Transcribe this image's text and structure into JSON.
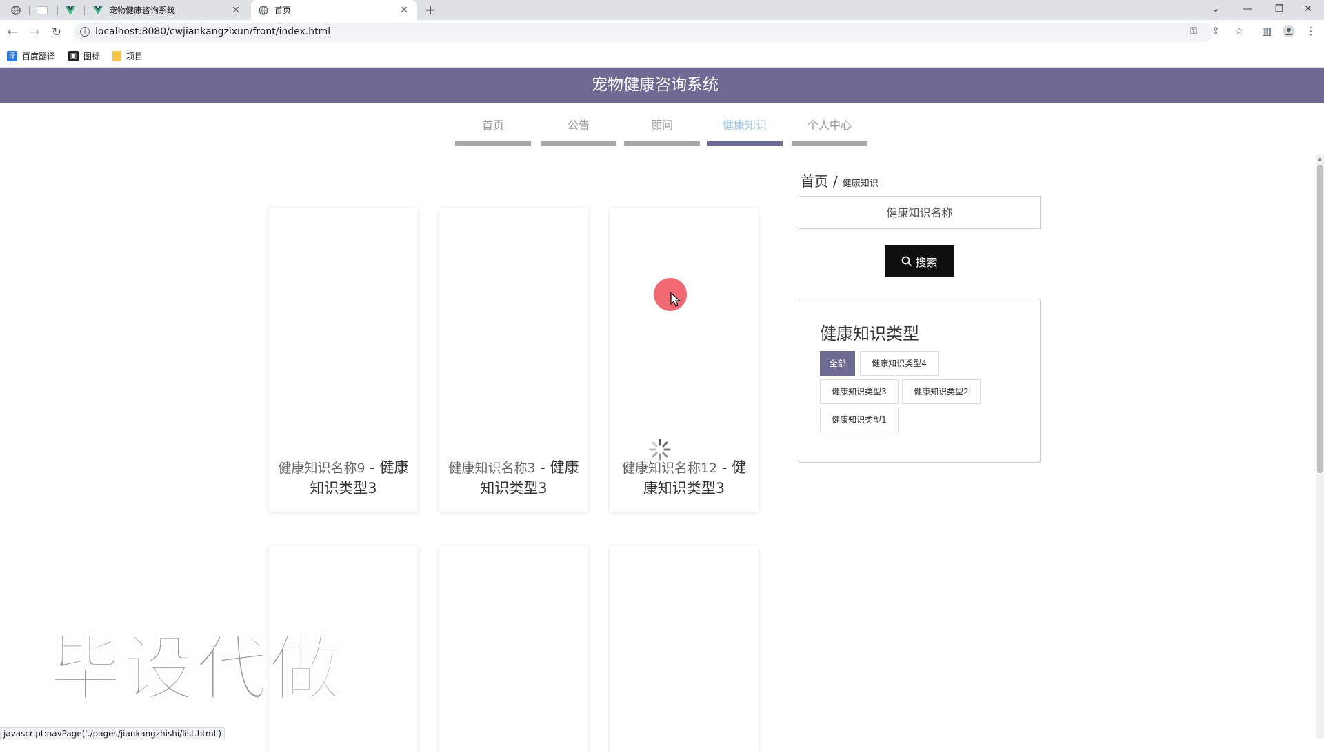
{
  "browser": {
    "tabs": [
      {
        "title": "宠物健康咨询系统",
        "active": false
      },
      {
        "title": "首页",
        "active": true
      }
    ],
    "url": "localhost:8080/cwjiankangzixun/front/index.html",
    "bookmarks": [
      "百度翻译",
      "图标",
      "项目"
    ],
    "status_text": "javascript:navPage('./pages/jiankangzhishi/list.html')"
  },
  "site": {
    "title": "宠物健康咨询系统",
    "nav": [
      "首页",
      "公告",
      "顾问",
      "健康知识",
      "个人中心"
    ],
    "active_nav": "健康知识"
  },
  "cards": [
    {
      "name": "健康知识名称9",
      "sep": " - ",
      "type": "健康知识类型3"
    },
    {
      "name": "健康知识名称3",
      "sep": " - ",
      "type": "健康知识类型3"
    },
    {
      "name": "健康知识名称12",
      "sep": " - ",
      "type": "健康知识类型3"
    }
  ],
  "sidebar": {
    "breadcrumb": {
      "home": "首页",
      "separator": "/",
      "current": "健康知识"
    },
    "search": {
      "placeholder": "健康知识名称",
      "button_label": "搜索"
    },
    "types": {
      "title": "健康知识类型",
      "tags": [
        "全部",
        "健康知识类型4",
        "健康知识类型3",
        "健康知识类型2",
        "健康知识类型1"
      ],
      "active_tag": "全部"
    }
  },
  "watermark": "毕设代做",
  "colors": {
    "header": "#6e6a93",
    "nav_active_text": "#9ec6e6",
    "nav_bar": "#a7a7a7",
    "button": "#0f0f0f"
  }
}
